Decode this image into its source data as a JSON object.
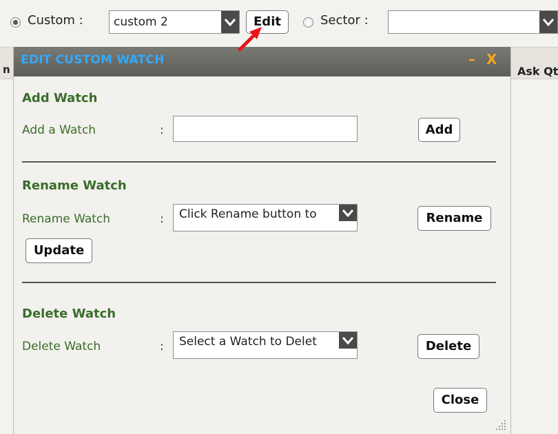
{
  "toolbar": {
    "custom_label": "Custom :",
    "custom_value": "custom 2",
    "edit_label": "Edit",
    "sector_label": "Sector :",
    "sector_value": ""
  },
  "background": {
    "left_fragment": "n",
    "right_column": "Ask Qt"
  },
  "dialog": {
    "title": "EDIT CUSTOM WATCH",
    "minimize_glyph": "–",
    "close_glyph": "X",
    "add": {
      "heading": "Add Watch",
      "label": "Add a Watch",
      "colon": ":",
      "value": "",
      "button": "Add"
    },
    "rename": {
      "heading": "Rename Watch",
      "label": "Rename Watch",
      "colon": ":",
      "select_value": "Click Rename button to",
      "button": "Rename",
      "update_button": "Update"
    },
    "delete": {
      "heading": "Delete Watch",
      "label": "Delete Watch",
      "colon": ":",
      "select_value": "Select a Watch to Delet",
      "button": "Delete"
    },
    "close_button": "Close"
  },
  "colors": {
    "title_blue": "#33a9ff",
    "section_green": "#3a6d2a",
    "window_control_orange": "#f5a623",
    "pointer_red": "#e8141b"
  },
  "icons": {
    "minimize": "minimize-icon",
    "close": "close-icon",
    "dropdown": "chevron-down-icon",
    "pointer": "red-arrow-icon",
    "resize": "resize-grip-icon"
  }
}
